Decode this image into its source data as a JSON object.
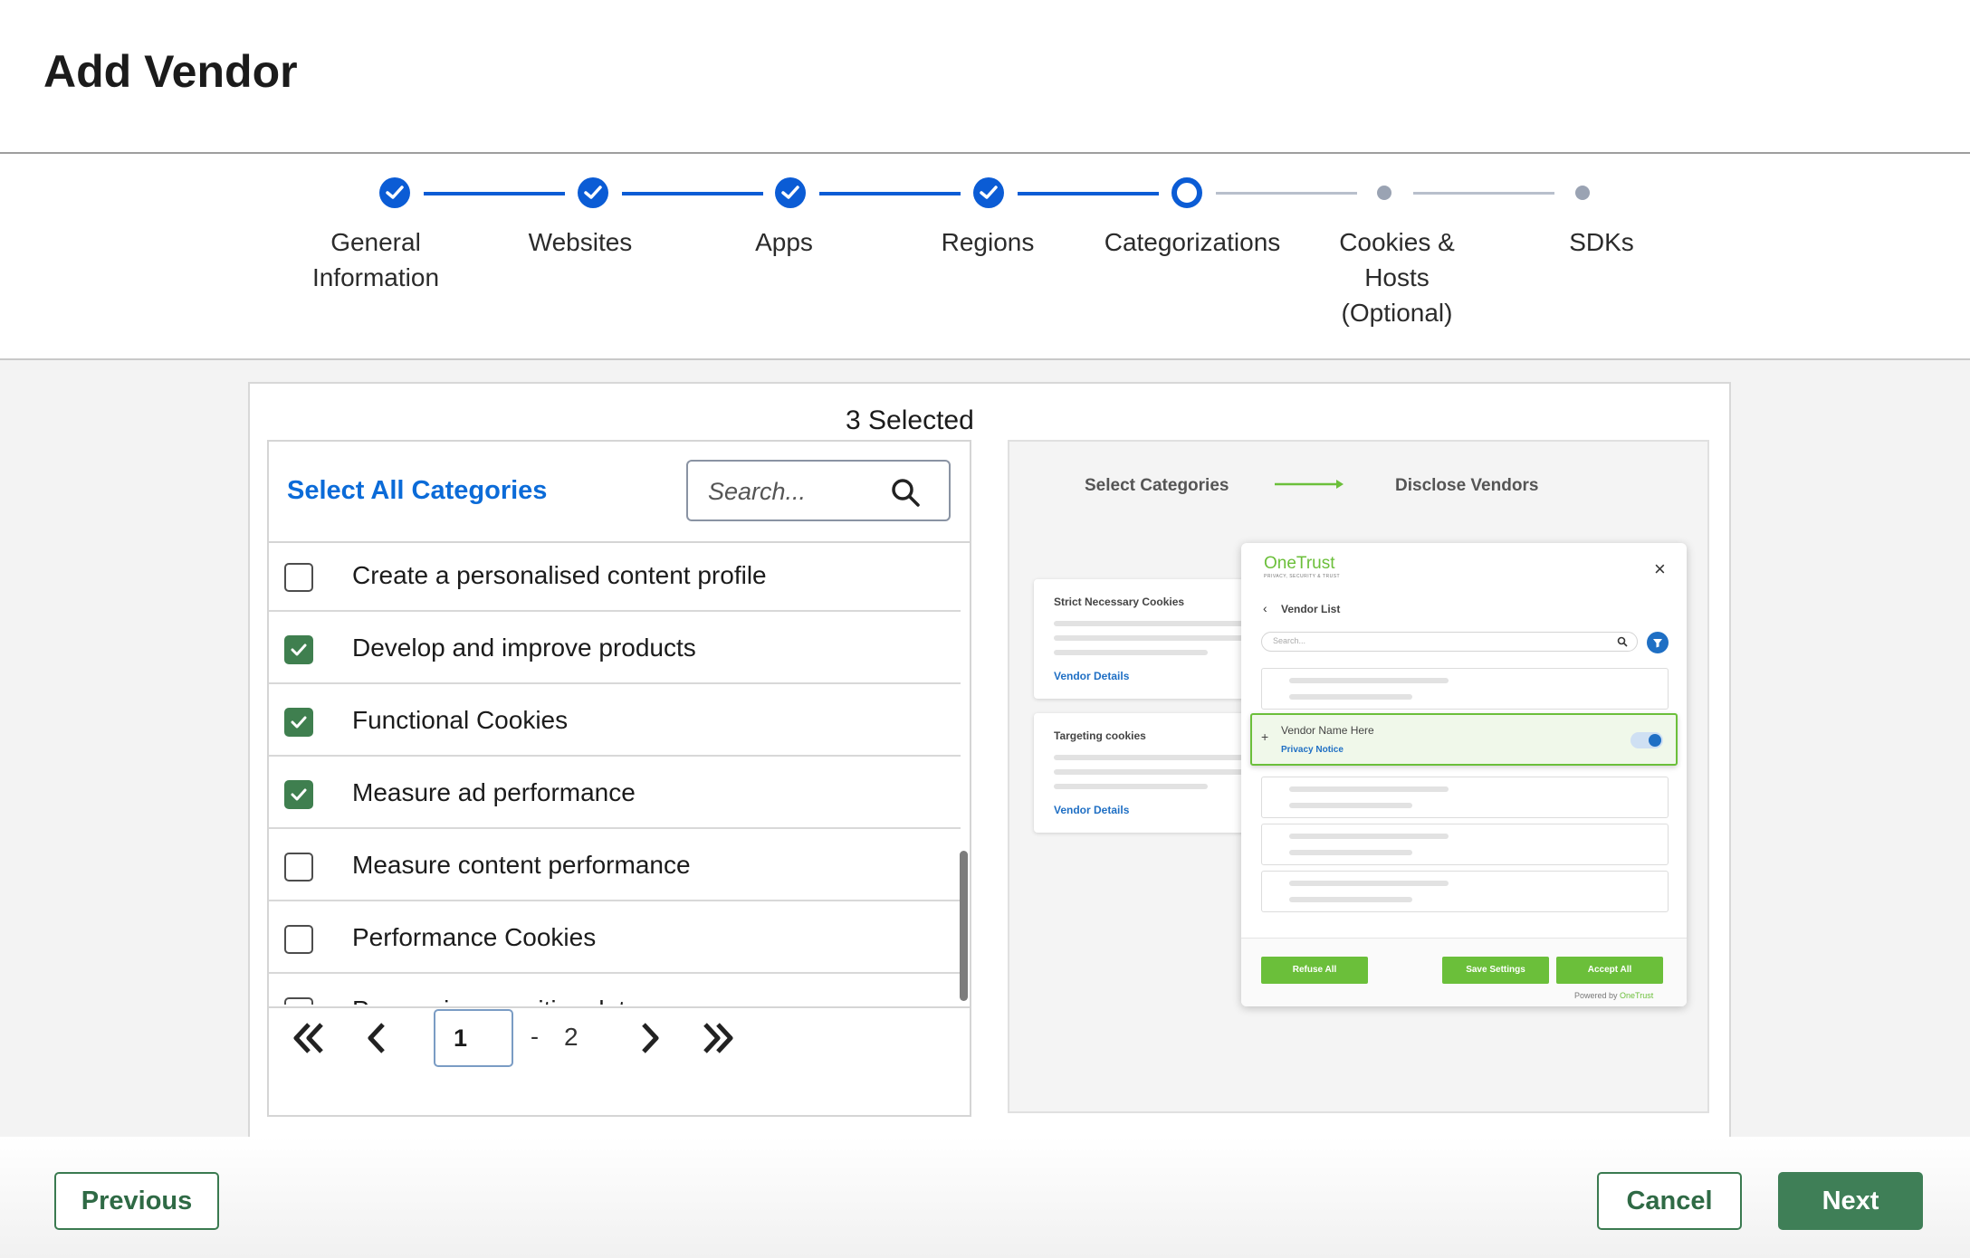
{
  "header": {
    "title": "Add Vendor"
  },
  "stepper": {
    "steps": [
      {
        "label": "General Information",
        "state": "done"
      },
      {
        "label": "Websites",
        "state": "done"
      },
      {
        "label": "Apps",
        "state": "done"
      },
      {
        "label": "Regions",
        "state": "done"
      },
      {
        "label": "Categorizations",
        "state": "current"
      },
      {
        "label": "Cookies & Hosts (Optional)",
        "state": "todo"
      },
      {
        "label": "SDKs",
        "state": "todo"
      }
    ],
    "colors": {
      "active": "#0b5cd5",
      "inactive": "#9aa3b3"
    }
  },
  "categories": {
    "selected_count": "3 Selected",
    "select_all_label": "Select All Categories",
    "search_placeholder": "Search...",
    "items": [
      {
        "label": "Create a personalised content profile",
        "checked": false
      },
      {
        "label": "Develop and improve products",
        "checked": true
      },
      {
        "label": "Functional Cookies",
        "checked": true
      },
      {
        "label": "Measure ad performance",
        "checked": true
      },
      {
        "label": "Measure content performance",
        "checked": false
      },
      {
        "label": "Performance Cookies",
        "checked": false
      },
      {
        "label": "Processing sensitive data",
        "checked": false
      }
    ],
    "pagination": {
      "current_page": "1",
      "separator": "-",
      "total_pages": "2"
    }
  },
  "preview": {
    "step1": "Select Categories",
    "step2": "Disclose Vendors",
    "cards": [
      {
        "title": "Strict Necessary Cookies",
        "link": "Vendor Details"
      },
      {
        "title": "Targeting cookies",
        "link": "Vendor Details"
      }
    ],
    "modal": {
      "logo": "OneTrust",
      "tagline": "PRIVACY, SECURITY & TRUST",
      "close": "×",
      "back": "‹",
      "title": "Vendor List",
      "search_placeholder": "Search...",
      "vendor_name": "Vendor Name Here",
      "privacy_notice": "Privacy Notice",
      "plus": "+",
      "refuse_all": "Refuse All",
      "save_settings": "Save Settings",
      "accept_all": "Accept All",
      "powered_by": "Powered by",
      "powered_brand": "OneTrust"
    }
  },
  "footer": {
    "previous": "Previous",
    "cancel": "Cancel",
    "next": "Next"
  },
  "theme": {
    "primary_green": "#3f7f57",
    "link_blue": "#0b6bd8",
    "onetrust_green": "#6bbf3a"
  }
}
